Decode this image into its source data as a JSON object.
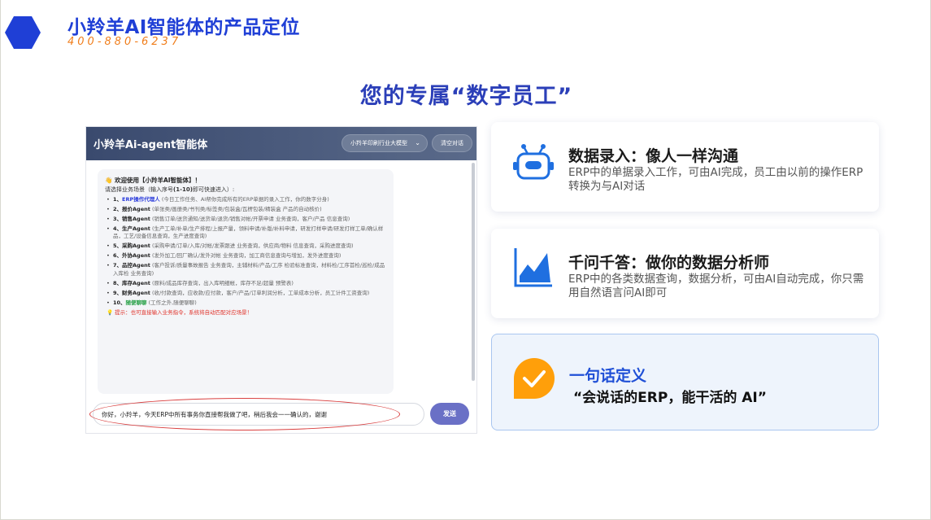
{
  "brand": {
    "title": "小羚羊AI智能体的产品定位",
    "phone": "400-880-6237"
  },
  "headline": "您的专属“数字员工”",
  "chat": {
    "title": "小羚羊Ai-agent智能体",
    "model_select": "小羚羊印刷行业大模型",
    "clear_label": "清空对话",
    "welcome": "👋 欢迎使用【小羚羊AI智能体】！",
    "prompt_prefix": "请选择业务场景（输入序号",
    "prompt_range": "(1-10)",
    "prompt_suffix": "即可快速进入）:",
    "items": [
      {
        "num": "1、",
        "name": "ERP操作代理人",
        "desc": "(今日工作任务、AI帮你完成所有的ERP单据的录入工作，你的数字分身)"
      },
      {
        "num": "2、",
        "name": "报价Agent",
        "desc": "(单张类/画册类/书刊类/标签类/包装盒/瓦楞包装/精装盒 产品的自动核价)"
      },
      {
        "num": "3、",
        "name": "销售Agent",
        "desc": "(销售订单/送货通知/送货单/退货/销售对帐/开票申请 业务查询，客户/产品 信息查询)"
      },
      {
        "num": "4、",
        "name": "生产Agent",
        "desc": "(生产工单/补单/生产排程/上报产量，领料申请/补版/补料申请，研发打样申请/研发打样工单/确认样品，工艺/设备信息查询，生产进度查询)"
      },
      {
        "num": "5、",
        "name": "采购Agent",
        "desc": "(采购申请/订单/入库/对帐/发票跟进 业务查询，供应商/物料 信息查询，采购进度查询)"
      },
      {
        "num": "6、",
        "name": "外协Agent",
        "desc": "(发外加工/回厂确认/发外对帐 业务查询，加工商信息查询与增加，发外进度查询)"
      },
      {
        "num": "7、",
        "name": "品控Agent",
        "desc": "(客户投诉/质量事故报告 业务查询，主辅材料/产品/工序 检验标准查询，材料检/工序首检/巡检/成品入库检 业务查询)"
      },
      {
        "num": "8、",
        "name": "库存Agent",
        "desc": "(原料/成品库存查询，出入库明细帐，库存不足/超量 预警表)"
      },
      {
        "num": "9、",
        "name": "财务Agent",
        "desc": "(收/付款查询，应收款/应付款，客户/产品/订单利润分析，工单成本分析，员工计件工资查询)"
      },
      {
        "num": "10、",
        "name": "随便聊聊",
        "desc": "(工作之外,随便聊聊)"
      }
    ],
    "tip": "💡 提示：也可直接输入业务指令，系统将自动匹配对应场景！",
    "input_value": "你好，小羚羊，今天ERP中所有事务你直接帮我做了吧，稍后我会一一确认的，谢谢",
    "send_label": "发送"
  },
  "cards": [
    {
      "title": "数据录入：像人一样沟通",
      "desc": "ERP中的单据录入工作，可由AI完成，员工由以前的操作ERP转换为与AI对话",
      "icon": "robot-icon"
    },
    {
      "title": "千问千答：做你的数据分析师",
      "desc": "ERP中的各类数据查询，数据分析，可由AI自动完成，你只需用自然语言问AI即可",
      "icon": "area-chart-icon"
    },
    {
      "title": "一句话定义",
      "desc": "“会说话的ERP，能干活的 AI”",
      "icon": "check-bubble-icon"
    }
  ],
  "colors": {
    "brand_blue": "#1f3fd6",
    "phone_orange": "#f07d1a",
    "icon_blue": "#1f6fe0",
    "check_orange": "#ff9f0a",
    "highlight_red": "#d94040"
  }
}
